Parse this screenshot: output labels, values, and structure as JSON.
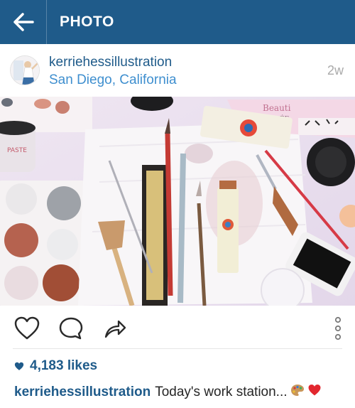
{
  "app_bar": {
    "title": "PHOTO",
    "background": "#1f5b8a",
    "back_icon": "arrow-left-icon"
  },
  "post": {
    "username": "kerriehessillustration",
    "location": "San Diego, California",
    "time_ago": "2w",
    "likes": "4,183 likes",
    "caption_user": "kerriehessillustration",
    "caption_text": "Today's work station...",
    "caption_emojis": [
      "palette-icon",
      "red-heart-icon"
    ]
  },
  "actions": {
    "like_icon": "heart-outline-icon",
    "comment_icon": "comment-bubble-icon",
    "share_icon": "share-arrow-icon",
    "more_icon": "more-vertical-icon"
  },
  "colors": {
    "link_blue": "#1f5b8a",
    "location_blue": "#3f8fcf",
    "timestamp_gray": "#aaaaaa"
  }
}
